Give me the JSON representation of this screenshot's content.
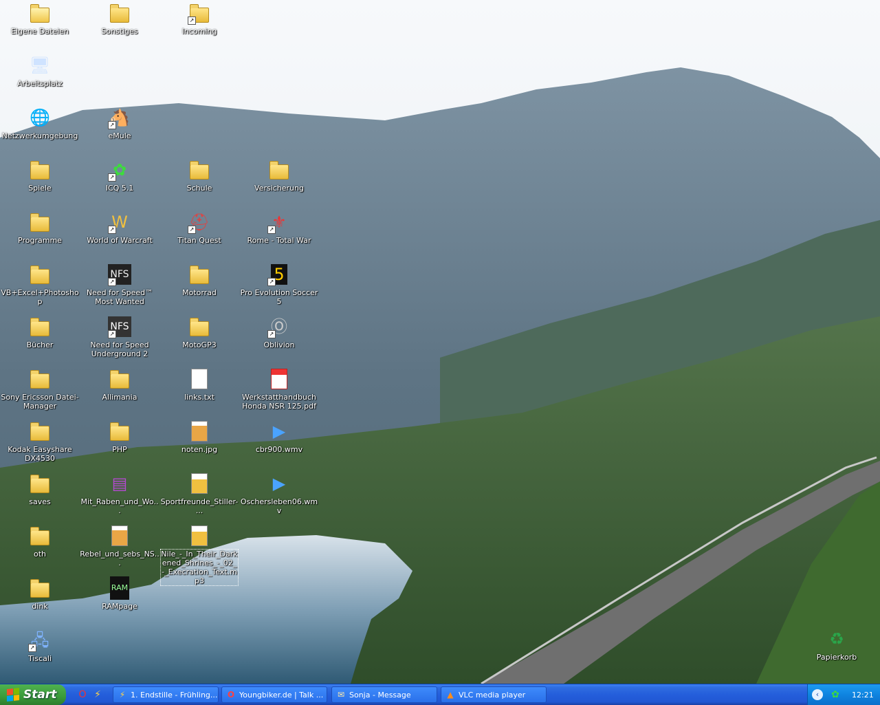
{
  "desktop": {
    "icons": [
      {
        "label": "Eigene Dateien",
        "type": "folder-docs",
        "col": 0,
        "row": 0
      },
      {
        "label": "Sonstiges",
        "type": "folder",
        "col": 1,
        "row": 0
      },
      {
        "label": "Incoming",
        "type": "folder",
        "shortcut": true,
        "col": 2,
        "row": 0
      },
      {
        "label": "Arbeitsplatz",
        "type": "computer",
        "col": 0,
        "row": 1
      },
      {
        "label": "Netzwerkumgebung",
        "type": "network",
        "col": 0,
        "row": 2
      },
      {
        "label": "eMule",
        "type": "app-emule",
        "shortcut": true,
        "col": 1,
        "row": 2
      },
      {
        "label": "Spiele",
        "type": "folder",
        "col": 0,
        "row": 3
      },
      {
        "label": "ICQ 5.1",
        "type": "app-icq",
        "shortcut": true,
        "col": 1,
        "row": 3
      },
      {
        "label": "Schule",
        "type": "folder",
        "col": 2,
        "row": 3
      },
      {
        "label": "Versicherung",
        "type": "folder",
        "col": 3,
        "row": 3
      },
      {
        "label": "Programme",
        "type": "folder",
        "col": 0,
        "row": 4
      },
      {
        "label": "World of Warcraft",
        "type": "app-wow",
        "shortcut": true,
        "col": 1,
        "row": 4
      },
      {
        "label": "Titan Quest",
        "type": "app-titan",
        "shortcut": true,
        "col": 2,
        "row": 4
      },
      {
        "label": "Rome - Total War",
        "type": "app-rome",
        "shortcut": true,
        "col": 3,
        "row": 4
      },
      {
        "label": "VB+Excel+Photoshop",
        "type": "folder",
        "col": 0,
        "row": 5
      },
      {
        "label": "Need for Speed™ Most Wanted",
        "type": "app-nfsmw",
        "shortcut": true,
        "col": 1,
        "row": 5
      },
      {
        "label": "Motorrad",
        "type": "folder",
        "col": 2,
        "row": 5
      },
      {
        "label": "Pro Evolution Soccer 5",
        "type": "app-pes",
        "shortcut": true,
        "col": 3,
        "row": 5
      },
      {
        "label": "Bücher",
        "type": "folder",
        "col": 0,
        "row": 6
      },
      {
        "label": "Need for Speed Underground 2",
        "type": "app-nfsu",
        "shortcut": true,
        "col": 1,
        "row": 6
      },
      {
        "label": "MotoGP3",
        "type": "folder",
        "col": 2,
        "row": 6
      },
      {
        "label": "Oblivion",
        "type": "app-oblivion",
        "shortcut": true,
        "col": 3,
        "row": 6
      },
      {
        "label": "Sony Ericsson Datei-Manager",
        "type": "folder-phone",
        "col": 0,
        "row": 7
      },
      {
        "label": "Allimania",
        "type": "folder",
        "col": 1,
        "row": 7
      },
      {
        "label": "links.txt",
        "type": "file-txt",
        "col": 2,
        "row": 7
      },
      {
        "label": "Werkstatthandbuch Honda NSR 125.pdf",
        "type": "file-pdf",
        "col": 3,
        "row": 7
      },
      {
        "label": "Kodak Easyshare DX4530",
        "type": "folder",
        "col": 0,
        "row": 8
      },
      {
        "label": "PHP",
        "type": "folder",
        "col": 1,
        "row": 8
      },
      {
        "label": "noten.jpg",
        "type": "file-jpg",
        "col": 2,
        "row": 8
      },
      {
        "label": "cbr900.wmv",
        "type": "file-wmv",
        "col": 3,
        "row": 8
      },
      {
        "label": "saves",
        "type": "folder",
        "col": 0,
        "row": 9
      },
      {
        "label": "Mit_Raben_und_Wo...",
        "type": "file-rar",
        "col": 1,
        "row": 9
      },
      {
        "label": "Sportfreunde_Stiller-...",
        "type": "file-mp3",
        "col": 2,
        "row": 9
      },
      {
        "label": "Oschersleben06.wmv",
        "type": "file-wmv",
        "col": 3,
        "row": 9
      },
      {
        "label": "oth",
        "type": "folder",
        "col": 0,
        "row": 10
      },
      {
        "label": "Rebel_und_sebs_NS...",
        "type": "file-jpg",
        "col": 1,
        "row": 10
      },
      {
        "label": "Nile_-_In_Their_Darkened_Shrines_-_02_-_Execration_Text.mp3",
        "type": "file-mp3",
        "selected": true,
        "col": 2,
        "row": 10
      },
      {
        "label": "dink",
        "type": "folder",
        "col": 0,
        "row": 11
      },
      {
        "label": "RAMpage",
        "type": "app-rampage",
        "col": 1,
        "row": 11
      },
      {
        "label": "Tiscali",
        "type": "network-tiscali",
        "shortcut": true,
        "col": 0,
        "row": 12
      }
    ],
    "recycle_bin": {
      "label": "Papierkorb"
    }
  },
  "taskbar": {
    "start_label": "Start",
    "quick_launch": [
      {
        "icon": "opera-icon",
        "glyph": "O"
      },
      {
        "icon": "winamp-icon",
        "glyph": "⚡"
      }
    ],
    "tasks": [
      {
        "label": "1. Endstille - Frühling...",
        "icon": "winamp-icon",
        "glyph": "⚡"
      },
      {
        "label": "Youngbiker.de | Talk ...",
        "icon": "opera-icon",
        "glyph": "O"
      },
      {
        "label": "Sonja - Message",
        "icon": "messenger-icon",
        "glyph": "✉"
      },
      {
        "label": "VLC media player",
        "icon": "vlc-icon",
        "glyph": "▲"
      }
    ],
    "tray": {
      "expand_icon": "chevron-left-icon",
      "tray_icon": "icq-flower-icon",
      "clock": "12:21"
    }
  }
}
